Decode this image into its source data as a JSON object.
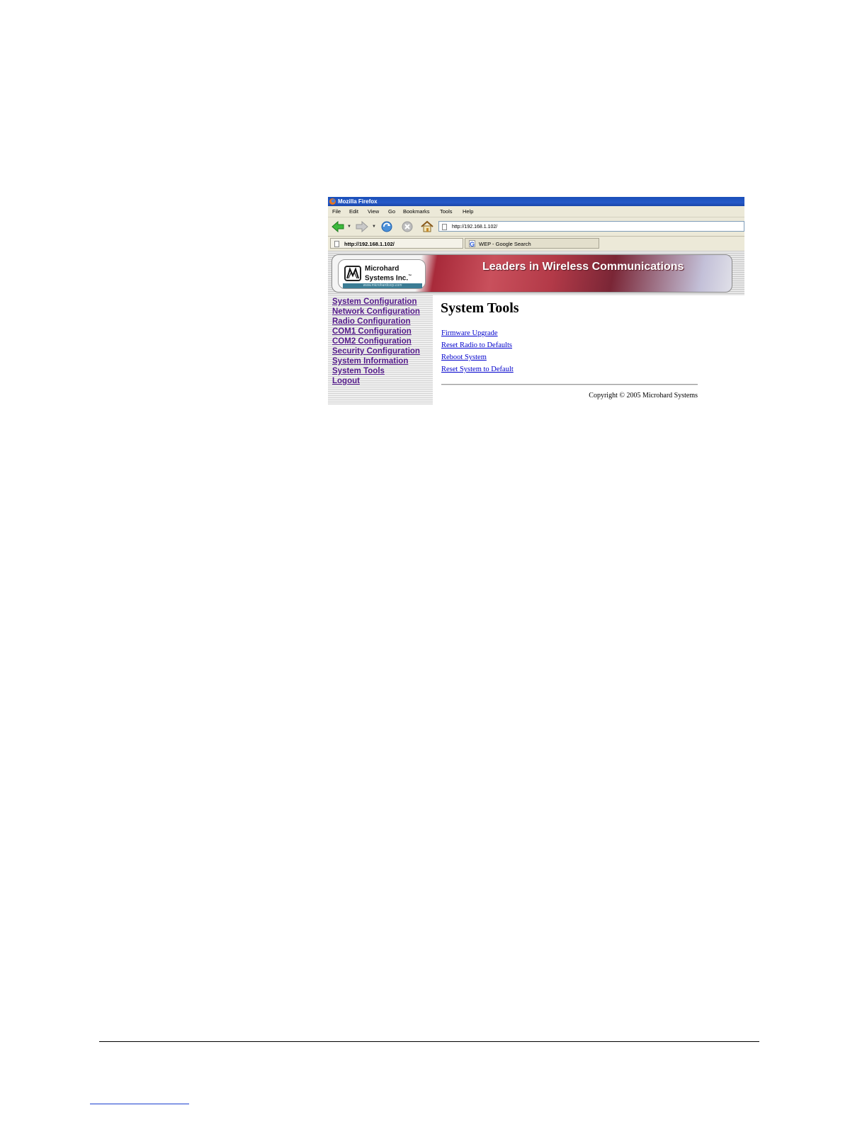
{
  "browser": {
    "title": "Mozilla Firefox",
    "menu": [
      "File",
      "Edit",
      "View",
      "Go",
      "Bookmarks",
      "Tools",
      "Help"
    ],
    "url": "http://192.168.1.102/",
    "tabs": [
      {
        "label": "http://192.168.1.102/",
        "icon": "page-icon",
        "active": true
      },
      {
        "label": "WEP - Google Search",
        "icon": "google-icon",
        "active": false
      }
    ],
    "toolbar_icons": [
      "back-icon",
      "forward-icon",
      "reload-icon",
      "stop-icon",
      "home-icon"
    ]
  },
  "banner": {
    "logo_line1": "Microhard",
    "logo_line2": "Systems Inc.",
    "logo_tm": "™",
    "logo_url": "www.microhardcorp.com",
    "tagline": "Leaders in Wireless Communications"
  },
  "sidebar": {
    "items": [
      "System Configuration",
      "Network Configuration",
      "Radio Configuration",
      "COM1 Configuration",
      "COM2 Configuration",
      "Security Configuration",
      "System Information",
      "System Tools",
      "Logout"
    ]
  },
  "content": {
    "heading": "System Tools",
    "links": [
      "Firmware Upgrade",
      "Reset Radio to Defaults",
      "Reboot System",
      "Reset System to Default"
    ],
    "copyright": "Copyright © 2005 Microhard Systems"
  },
  "colors": {
    "visited_link": "#551a8b",
    "link": "#0000cc",
    "titlebar": "#2559c9",
    "chrome": "#ece9d8"
  }
}
